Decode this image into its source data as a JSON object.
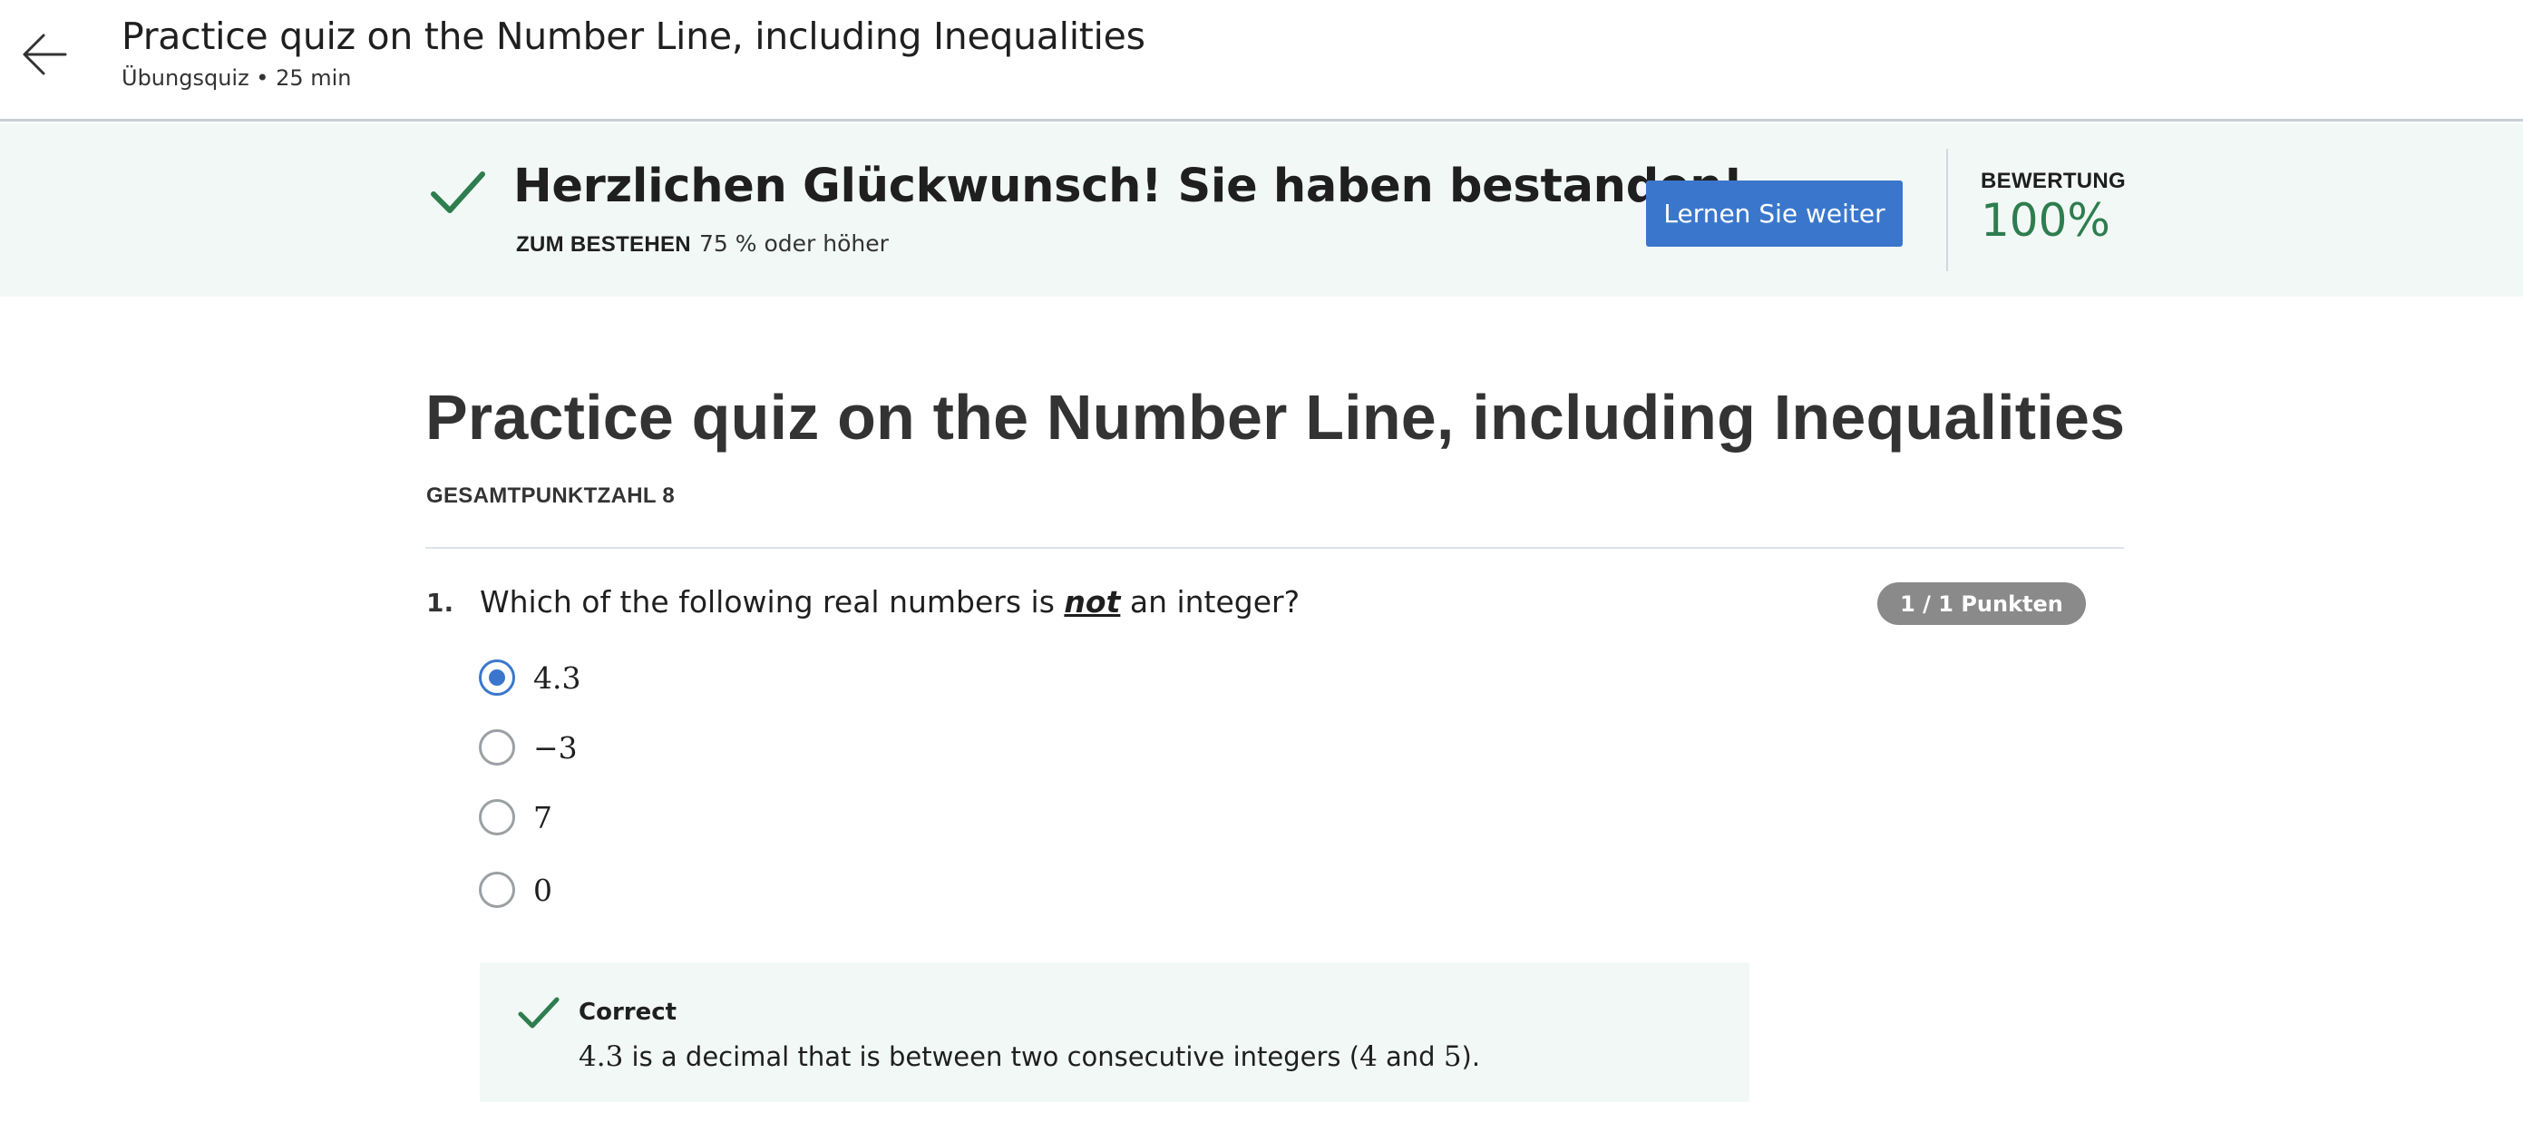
{
  "header": {
    "back_icon": "arrow-left-icon",
    "title": "Practice quiz on the Number Line, including Inequalities",
    "subtitle": "Übungsquiz • 25 min"
  },
  "banner": {
    "check_icon": "checkmark-icon",
    "message": "Herzlichen Glückwunsch! Sie haben bestanden!",
    "pass_label": "ZUM BESTEHEN",
    "pass_value": "75 % oder höher",
    "continue_label": "Lernen Sie weiter",
    "grade_label": "BEWERTUNG",
    "grade_value": "100%",
    "grade_percent": 100,
    "colors": {
      "background": "#f2f8f6",
      "success": "#2e7d4f",
      "button": "#3a77cc"
    }
  },
  "quiz": {
    "title": "Practice quiz on the Number Line, including Inequalities",
    "total_points_label": "GESAMTPUNKTZAHL 8"
  },
  "question": {
    "number": "1.",
    "text_before": "Which of the following real numbers is ",
    "text_emphasis": "not",
    "text_after": " an integer?",
    "points": "1 / 1 Punkten",
    "options": [
      {
        "label": "4.3",
        "selected": true
      },
      {
        "label": "−3",
        "selected": false
      },
      {
        "label": "7",
        "selected": false
      },
      {
        "label": "0",
        "selected": false
      }
    ]
  },
  "feedback": {
    "check_icon": "checkmark-icon",
    "title": "Correct",
    "value": "4.3",
    "text_middle": " is a decimal that is between two consecutive integers (",
    "int_a": "4",
    "text_and": " and ",
    "int_b": "5",
    "text_end": ")."
  }
}
